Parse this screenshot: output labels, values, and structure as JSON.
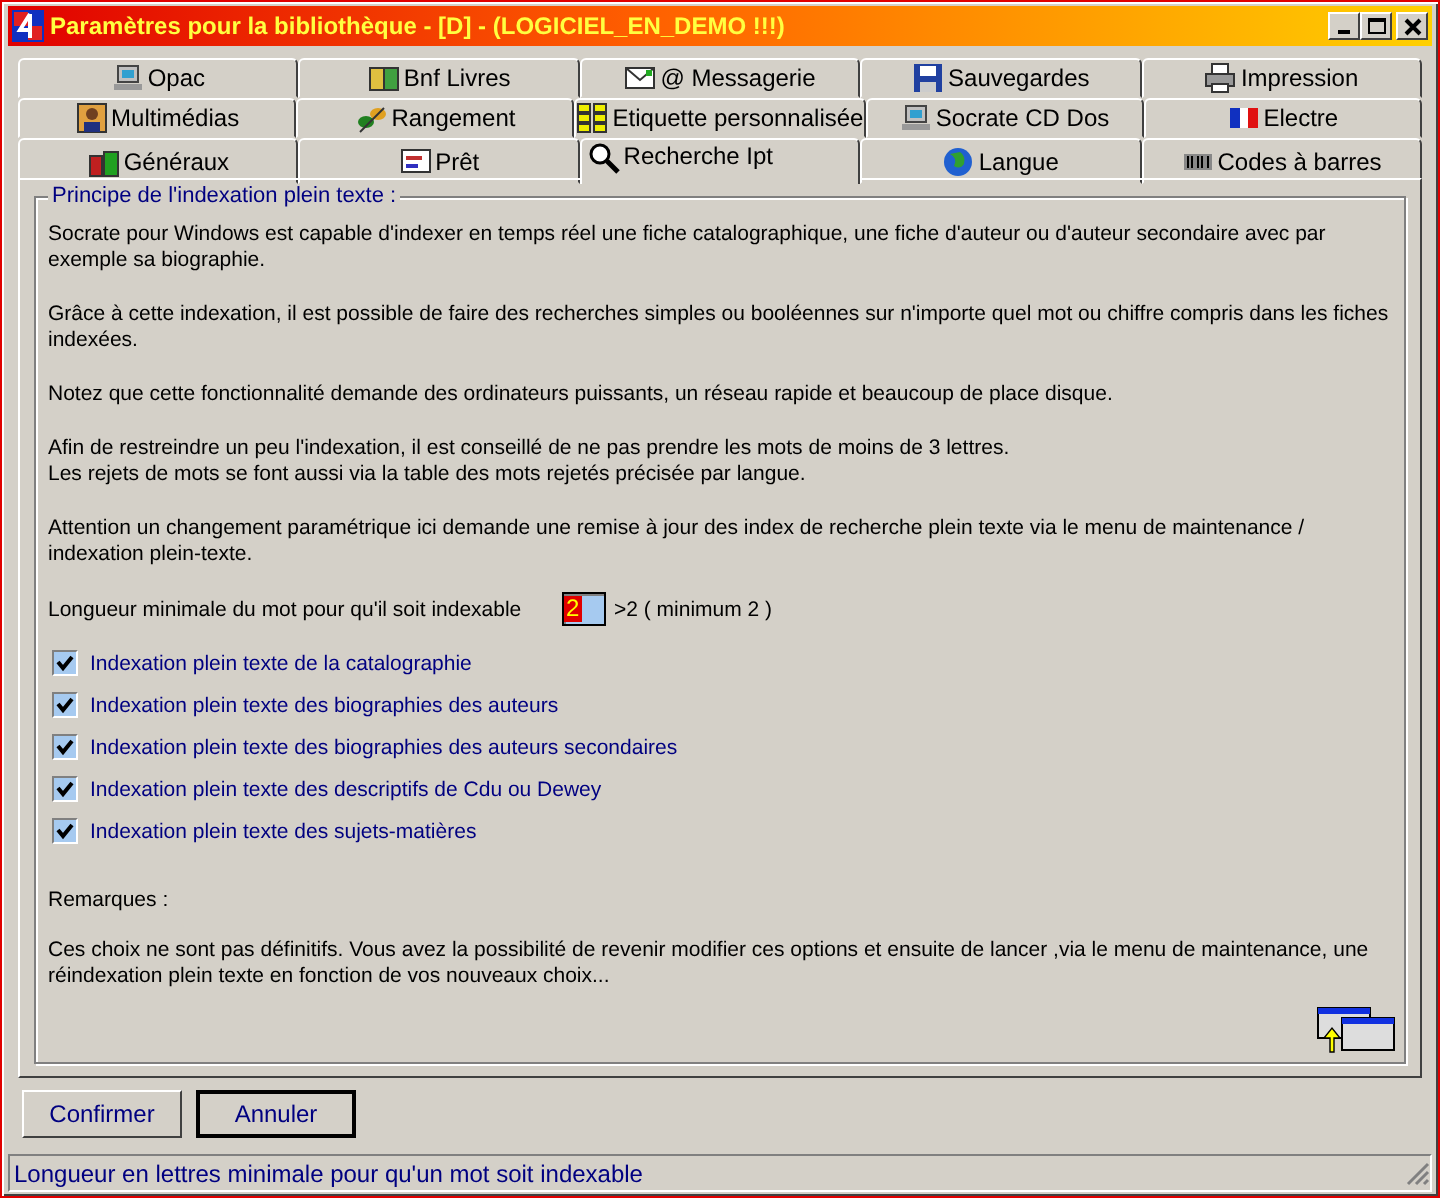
{
  "window": {
    "title": "Paramètres pour la bibliothèque - [D] - (LOGICIEL_EN_DEMO !!!)"
  },
  "tabs": [
    [
      {
        "label": "Opac",
        "selected": false
      },
      {
        "label": "Bnf Livres",
        "selected": false
      },
      {
        "label": "@ Messagerie",
        "selected": false
      },
      {
        "label": "Sauvegardes",
        "selected": false
      },
      {
        "label": "Impression",
        "selected": false
      }
    ],
    [
      {
        "label": "Multimédias",
        "selected": false
      },
      {
        "label": "Rangement",
        "selected": false
      },
      {
        "label": "Etiquette personnalisée",
        "selected": false
      },
      {
        "label": "Socrate CD Dos",
        "selected": false
      },
      {
        "label": "Electre",
        "selected": false
      }
    ],
    [
      {
        "label": "Généraux",
        "selected": false
      },
      {
        "label": "Prêt",
        "selected": false
      },
      {
        "label": "Recherche Ipt",
        "selected": true
      },
      {
        "label": "Langue",
        "selected": false
      },
      {
        "label": "Codes à barres",
        "selected": false
      }
    ]
  ],
  "group": {
    "title": "Principe de l'indexation plein texte :",
    "paragraphs": [
      "Socrate pour Windows est capable d'indexer en temps réel une fiche catalographique, une fiche d'auteur ou d'auteur secondaire avec par\nexemple sa biographie.",
      "Grâce à cette indexation, il est possible de faire des recherches simples ou booléennes sur n'importe quel mot ou chiffre compris dans les fiches\nindexées.",
      "Notez que cette fonctionnalité demande des ordinateurs puissants, un réseau rapide et beaucoup de place disque.",
      "Afin de restreindre un peu l'indexation, il est conseillé de ne pas prendre les mots de moins de 3 lettres.\nLes rejets de mots se font aussi via la table des mots rejetés précisée par langue.",
      "Attention un changement paramétrique ici demande une remise à jour des index de recherche plein texte via le menu de maintenance /\nindexation plein-texte."
    ],
    "length_field": {
      "label": "Longueur minimale du mot pour qu'il soit indexable",
      "value": "2",
      "hint": ">2 ( minimum 2 )"
    },
    "options": [
      {
        "label": "Indexation plein texte de la catalographie",
        "checked": true
      },
      {
        "label": "Indexation plein texte des biographies des auteurs",
        "checked": true
      },
      {
        "label": "Indexation plein texte des biographies des auteurs secondaires",
        "checked": true
      },
      {
        "label": "Indexation plein texte des descriptifs de Cdu ou Dewey",
        "checked": true
      },
      {
        "label": "Indexation plein texte des sujets-matières",
        "checked": true
      }
    ],
    "remarks_title": "Remarques :",
    "remarks": "Ces choix ne sont pas définitifs. Vous avez la possibilité de revenir modifier ces options et ensuite de lancer ,via le menu de maintenance, une\nréindexation plein texte en fonction de vos nouveaux choix..."
  },
  "buttons": [
    "Confirmer",
    "Annuler"
  ],
  "status_bar": "Longueur en lettres minimale pour qu'un mot soit indexable"
}
